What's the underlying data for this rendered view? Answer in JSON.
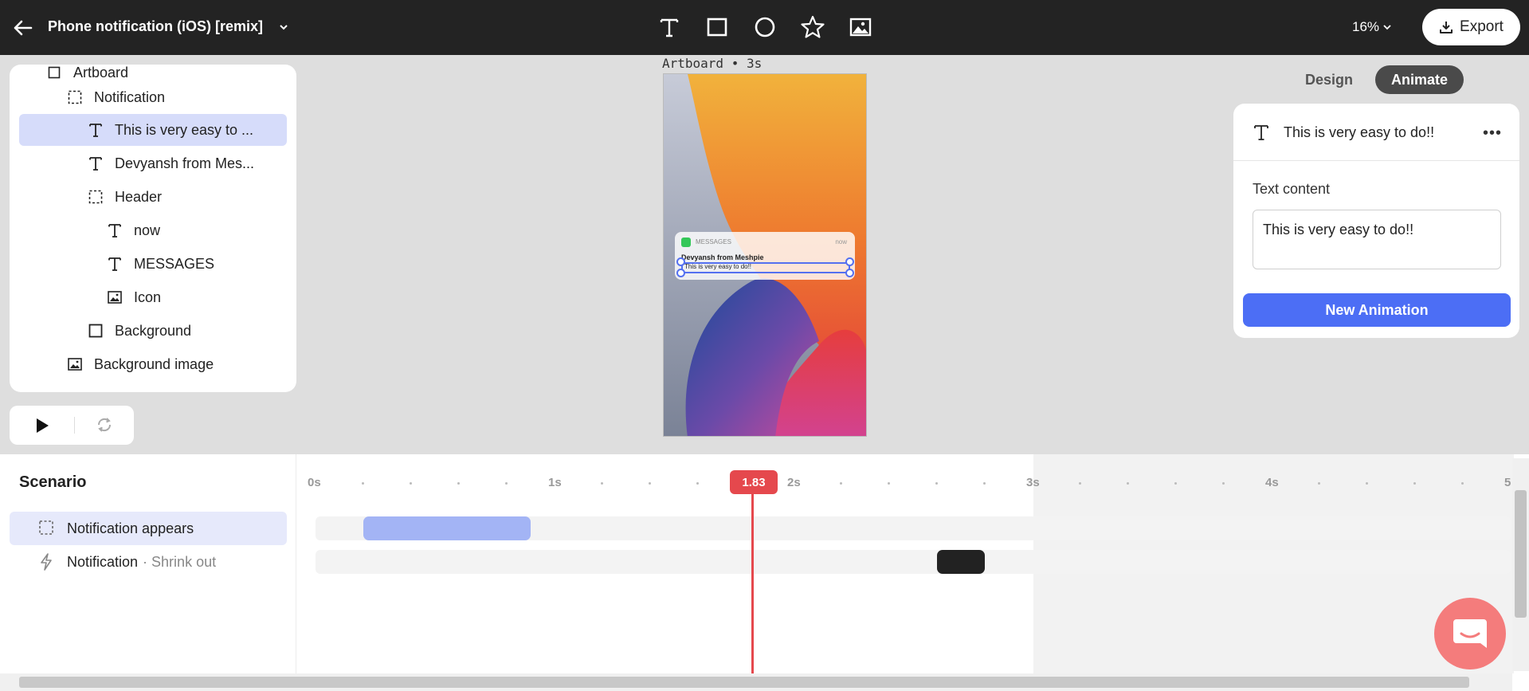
{
  "header": {
    "doc_title": "Phone notification (iOS) [remix]",
    "tools": [
      "text-tool",
      "rectangle-tool",
      "ellipse-tool",
      "star-tool",
      "image-tool"
    ],
    "zoom": "16%",
    "export_label": "Export"
  },
  "layers": {
    "partial_top": "Artboard",
    "items": [
      {
        "label": "Notification",
        "icon": "frame-icon"
      },
      {
        "label": "This is very easy to ...",
        "icon": "text-icon",
        "selected": true
      },
      {
        "label": "Devyansh from Mes...",
        "icon": "text-icon"
      },
      {
        "label": "Header",
        "icon": "frame-icon"
      },
      {
        "label": "now",
        "icon": "text-icon"
      },
      {
        "label": "MESSAGES",
        "icon": "text-icon"
      },
      {
        "label": "Icon",
        "icon": "image-icon"
      },
      {
        "label": "Background",
        "icon": "rectangle-icon"
      },
      {
        "label": "Background image",
        "icon": "image-icon"
      }
    ]
  },
  "canvas": {
    "artboard_label": "Artboard • 3s",
    "notification": {
      "app": "MESSAGES",
      "time": "now",
      "sender": "Devyansh from Meshpie",
      "body": "This is very easy to do!!"
    }
  },
  "right_panel": {
    "tabs": [
      "Design",
      "Animate"
    ],
    "active_tab": "Animate",
    "selected_title": "This is very easy to do!!",
    "text_content_label": "Text content",
    "text_content_value": "This is very easy to do!!",
    "new_animation_label": "New Animation"
  },
  "timeline": {
    "scenario_title": "Scenario",
    "scenarios": [
      {
        "label": "Notification appears",
        "active": true,
        "icon": "frame-icon"
      },
      {
        "label": "Notification",
        "sub": "· Shrink out",
        "icon": "lightning-icon"
      }
    ],
    "ticks": [
      "0s",
      "1s",
      "2s",
      "3s",
      "4s",
      "5"
    ],
    "playhead": "1.83",
    "clip_colors": {
      "appear": "#a3b4f5",
      "shrink": "#222222"
    },
    "accent": "#e5484d"
  }
}
